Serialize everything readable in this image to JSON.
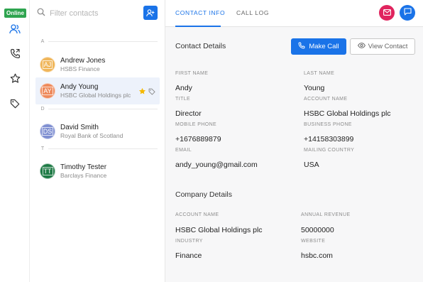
{
  "rail": {
    "status": "Online",
    "icons": [
      "contacts-icon",
      "call-history-icon",
      "favorites-icon",
      "tags-icon"
    ]
  },
  "contacts_panel": {
    "search_placeholder": "Filter contacts",
    "groups": [
      {
        "letter": "A",
        "contacts": [
          {
            "initials": "AJ",
            "name": "Andrew Jones",
            "company": "HSBS Finance",
            "color": "#f0b65a",
            "selected": false
          },
          {
            "initials": "AY",
            "name": "Andy Young",
            "company": "HSBC Global Holdings plc",
            "color": "#ee8a5c",
            "selected": true,
            "favorite": true
          }
        ]
      },
      {
        "letter": "D",
        "contacts": [
          {
            "initials": "DS",
            "name": "David Smith",
            "company": "Royal Bank of Scotland",
            "color": "#7f8fd1",
            "selected": false
          }
        ]
      },
      {
        "letter": "T",
        "contacts": [
          {
            "initials": "TT",
            "name": "Timothy Tester",
            "company": "Barclays Finance",
            "color": "#1e7a45",
            "selected": false
          }
        ]
      }
    ]
  },
  "tabs": [
    {
      "label": "CONTACT INFO",
      "active": true
    },
    {
      "label": "CALL LOG",
      "active": false
    }
  ],
  "header_buttons": {
    "email_color": "#e0245e",
    "chat_color": "#1a73e8"
  },
  "contact_details": {
    "title": "Contact Details",
    "make_call_label": "Make Call",
    "view_contact_label": "View Contact",
    "fields": {
      "first_name": {
        "label": "FIRST NAME",
        "value": "Andy"
      },
      "last_name": {
        "label": "LAST NAME",
        "value": "Young"
      },
      "title": {
        "label": "TITLE",
        "value": "Director"
      },
      "account_name": {
        "label": "ACCOUNT NAME",
        "value": "HSBC Global Holdings plc"
      },
      "mobile_phone": {
        "label": "MOBILE PHONE",
        "value": "+1676889879"
      },
      "business_phone": {
        "label": "BUSINESS PHONE",
        "value": "+14158303899"
      },
      "email": {
        "label": "EMAIL",
        "value": "andy_young@gmail.com"
      },
      "mailing_country": {
        "label": "MAILING COUNTRY",
        "value": "USA"
      }
    }
  },
  "company_details": {
    "title": "Company Details",
    "fields": {
      "account_name": {
        "label": "ACCOUNT NAME",
        "value": "HSBC Global Holdings plc"
      },
      "annual_revenue": {
        "label": "ANNUAL REVENUE",
        "value": "50000000"
      },
      "industry": {
        "label": "INDUSTRY",
        "value": "Finance"
      },
      "website": {
        "label": "WEBSITE",
        "value": "hsbc.com"
      }
    }
  }
}
